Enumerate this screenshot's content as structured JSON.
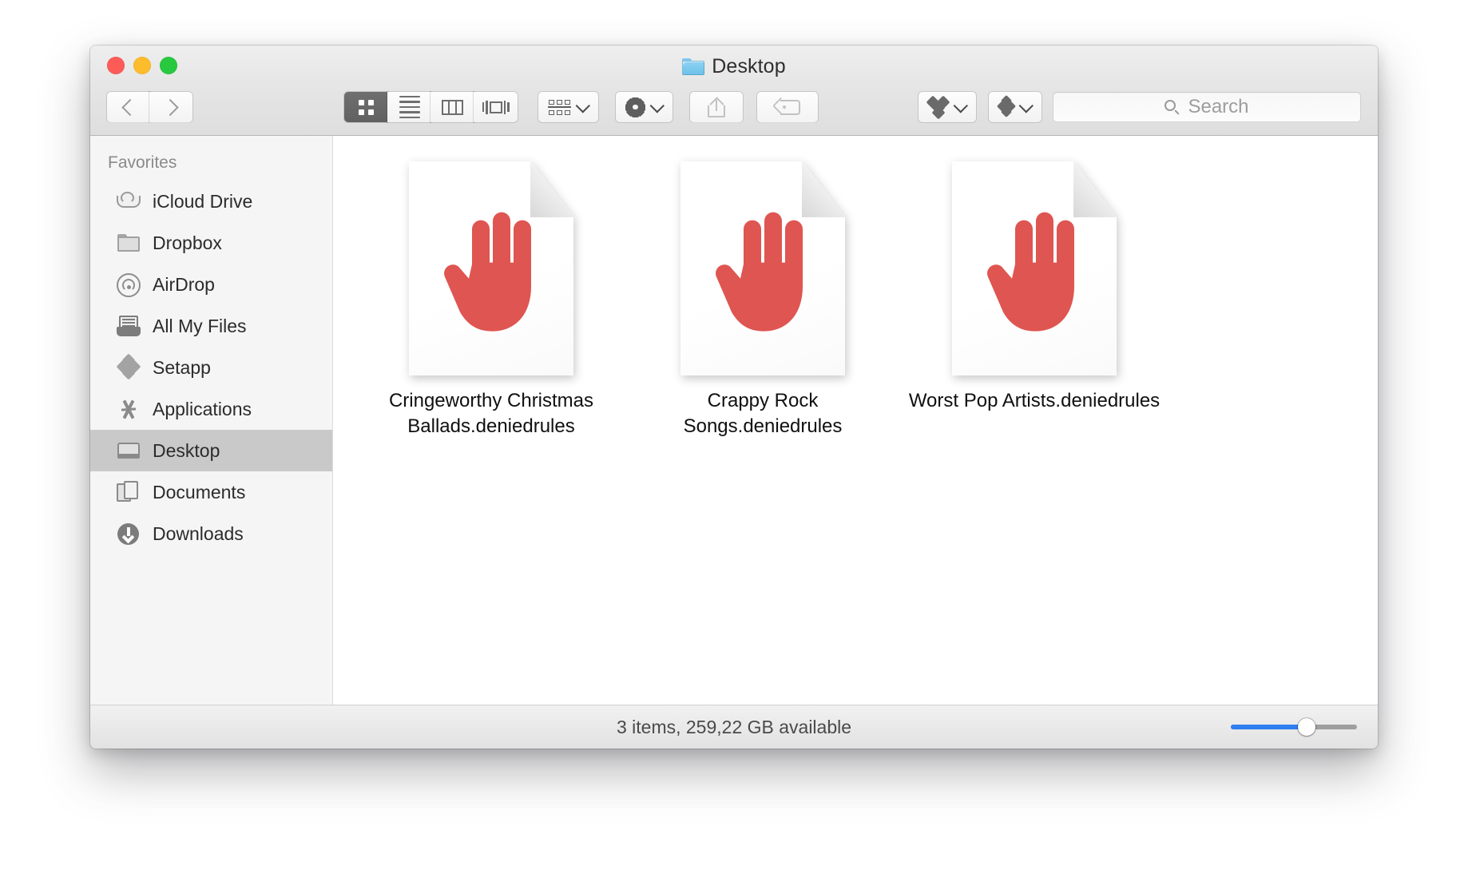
{
  "window": {
    "title": "Desktop",
    "title_icon": "blue-folder-icon",
    "controls": {
      "close": "close-window-button",
      "minimize": "minimize-window-button",
      "zoom": "zoom-window-button"
    }
  },
  "toolbar": {
    "back_label": "Back",
    "forward_label": "Forward",
    "view_modes": [
      {
        "id": "icon",
        "label": "Icon View",
        "selected": true
      },
      {
        "id": "list",
        "label": "List View",
        "selected": false
      },
      {
        "id": "column",
        "label": "Column View",
        "selected": false
      },
      {
        "id": "cover",
        "label": "Cover Flow View",
        "selected": false
      }
    ],
    "arrange_label": "Arrange",
    "action_label": "Action",
    "share_label": "Share",
    "tags_label": "Edit Tags",
    "dropbox_label": "Dropbox",
    "setapp_label": "Setapp"
  },
  "search": {
    "placeholder": "Search",
    "value": ""
  },
  "sidebar": {
    "header": "Favorites",
    "items": [
      {
        "label": "iCloud Drive",
        "icon": "icloud-drive-icon",
        "selected": false
      },
      {
        "label": "Dropbox",
        "icon": "folder-icon",
        "selected": false
      },
      {
        "label": "AirDrop",
        "icon": "airdrop-icon",
        "selected": false
      },
      {
        "label": "All My Files",
        "icon": "all-my-files-icon",
        "selected": false
      },
      {
        "label": "Setapp",
        "icon": "setapp-icon",
        "selected": false
      },
      {
        "label": "Applications",
        "icon": "applications-icon",
        "selected": false
      },
      {
        "label": "Desktop",
        "icon": "desktop-icon",
        "selected": true
      },
      {
        "label": "Documents",
        "icon": "documents-icon",
        "selected": false
      },
      {
        "label": "Downloads",
        "icon": "downloads-icon",
        "selected": false
      }
    ]
  },
  "files": [
    {
      "name": "Cringeworthy Christmas Ballads.deniedrules",
      "icon": "denied-document-icon"
    },
    {
      "name": "Crappy Rock Songs.deniedrules",
      "icon": "denied-document-icon"
    },
    {
      "name": "Worst Pop Artists.deniedrules",
      "icon": "denied-document-icon"
    }
  ],
  "statusbar": {
    "text": "3 items, 259,22 GB available",
    "zoom_slider_value": 60
  },
  "colors": {
    "hand_red": "#df5551",
    "selection_gray": "#c9c9c9",
    "slider_blue": "#2f7ff0",
    "sidebar_bg": "#f5f5f5",
    "traffic_red": "#fc5b57",
    "traffic_yellow": "#fdbc2b",
    "traffic_green": "#28c83f"
  }
}
